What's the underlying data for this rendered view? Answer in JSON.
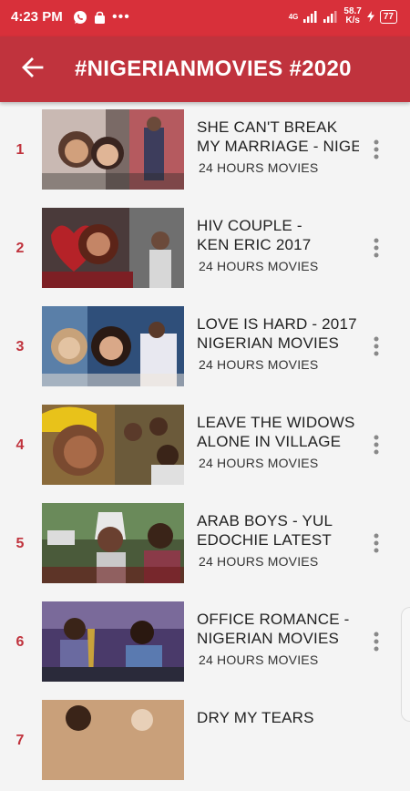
{
  "status_bar": {
    "time": "4:23 PM",
    "network": "4G",
    "speed_value": "58.7",
    "speed_unit": "K/s",
    "battery": "77"
  },
  "app_bar": {
    "title": "#NIGERIANMOVIES #2020"
  },
  "colors": {
    "status_bar": "#d8303a",
    "app_bar": "#c0333d",
    "accent_number": "#c0333d",
    "background": "#f4f4f4"
  },
  "videos": [
    {
      "index": "1",
      "title_line1": "SHE CAN'T BREAK",
      "title_line2": "MY MARRIAGE - NIGE-",
      "channel": "24 HOURS MOVIES"
    },
    {
      "index": "2",
      "title_line1": "HIV COUPLE -",
      "title_line2": "KEN ERIC  2017",
      "channel": "24 HOURS MOVIES"
    },
    {
      "index": "3",
      "title_line1": "LOVE IS HARD  - 2017",
      "title_line2": "NIGERIAN MOVIES",
      "channel": "24 HOURS MOVIES"
    },
    {
      "index": "4",
      "title_line1": "LEAVE THE WIDOWS",
      "title_line2": "ALONE IN VILLAGE",
      "channel": "24 HOURS MOVIES"
    },
    {
      "index": "5",
      "title_line1": "ARAB BOYS - YUL",
      "title_line2": "EDOCHIE LATEST",
      "channel": "24 HOURS MOVIES"
    },
    {
      "index": "6",
      "title_line1": "OFFICE ROMANCE -",
      "title_line2": "NIGERIAN MOVIES",
      "channel": "24 HOURS MOVIES"
    },
    {
      "index": "7",
      "title_line1": "DRY MY TEARS",
      "title_line2": "",
      "channel": ""
    }
  ]
}
